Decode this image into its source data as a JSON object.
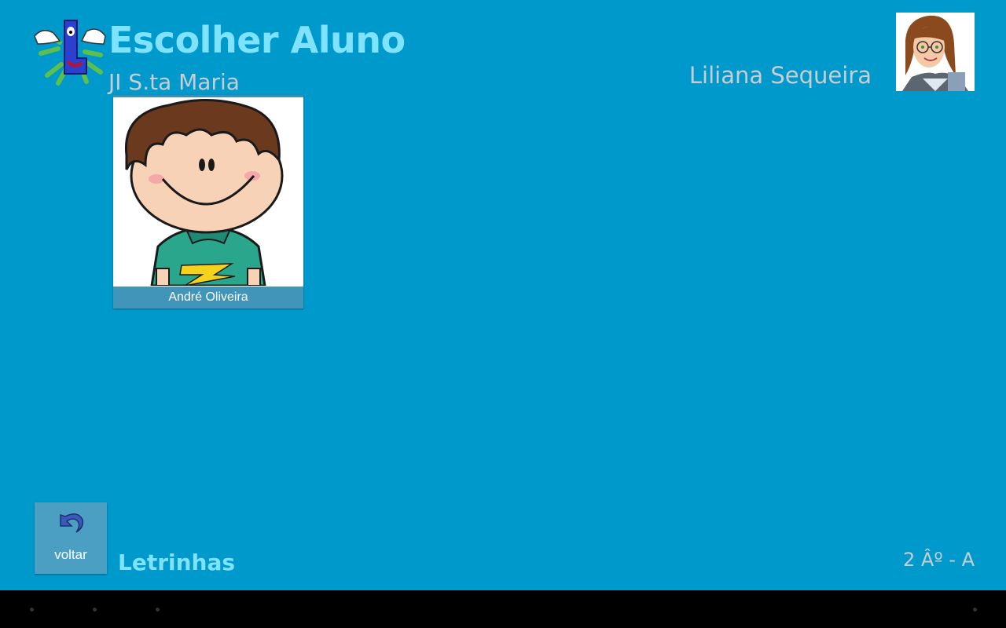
{
  "header": {
    "title": "Escolher Aluno",
    "school": "JI S.ta Maria",
    "teacher_name": "Liliana Sequeira"
  },
  "students": [
    {
      "name": "André Oliveira"
    }
  ],
  "footer": {
    "back_label": "voltar",
    "app_name": "Letrinhas",
    "class_label": "2 Âº - A"
  },
  "colors": {
    "background": "#0099cc",
    "title": "#7fe3ff",
    "subtitle": "#c7ced3",
    "card_label": "#4195b8"
  },
  "icons": {
    "app_logo": "letter-l-mascot-icon",
    "teacher_avatar": "teacher-avatar-icon",
    "back": "undo-arrow-icon",
    "nav": [
      "nav-back-dot",
      "nav-home-dot",
      "nav-recent-dot",
      "nav-menu-dot"
    ]
  }
}
